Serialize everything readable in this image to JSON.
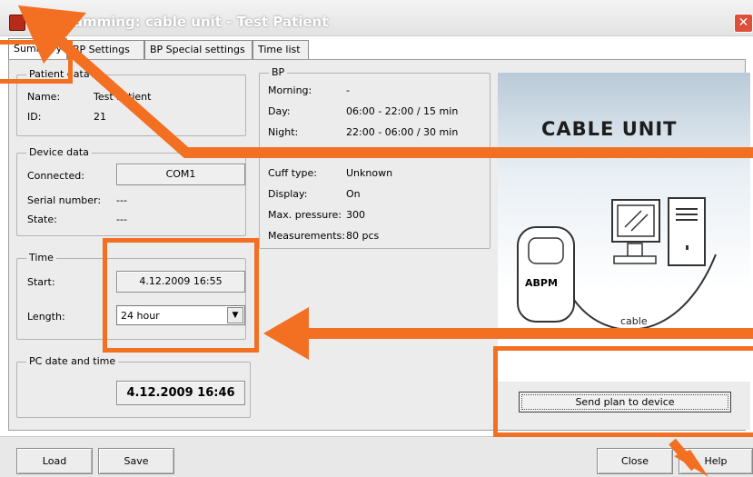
{
  "window": {
    "title": "Programming: cable unit - Test Patient",
    "close_glyph": "✕"
  },
  "tabs": [
    {
      "label": "Summary"
    },
    {
      "label": "BP Settings"
    },
    {
      "label": "BP Special settings"
    },
    {
      "label": "Time list"
    }
  ],
  "patient": {
    "group": "Patient data",
    "name_label": "Name:",
    "name_value": "Test Patient",
    "id_label": "ID:",
    "id_value": "21"
  },
  "device": {
    "group": "Device data",
    "connected_label": "Connected:",
    "connected_value": "COM1",
    "serial_label": "Serial number:",
    "serial_value": "---",
    "state_label": "State:",
    "state_value": "---"
  },
  "time": {
    "group": "Time",
    "start_label": "Start:",
    "start_value": "4.12.2009 16:55",
    "length_label": "Length:",
    "length_value": "24 hour"
  },
  "pc": {
    "group": "PC date and time",
    "value": "4.12.2009 16:46"
  },
  "bp": {
    "group": "BP",
    "morning_label": "Morning:",
    "morning_value": "-",
    "day_label": "Day:",
    "day_value": "06:00 - 22:00 / 15 min",
    "night_label": "Night:",
    "night_value": "22:00 - 06:00 / 30 min",
    "cuff_label": "Cuff type:",
    "cuff_value": "Unknown",
    "display_label": "Display:",
    "display_value": "On",
    "maxp_label": "Max. pressure:",
    "maxp_value": "300",
    "meas_label": "Measurements:",
    "meas_value": "80 pcs"
  },
  "image": {
    "title": "CABLE UNIT",
    "abpm_label": "ABPM",
    "cable_label": "cable"
  },
  "send_button": "Send plan to device",
  "buttons": {
    "load": "Load",
    "save": "Save",
    "close": "Close",
    "help": "Help"
  },
  "colors": {
    "annotation": "#f36f22",
    "titlebar_close": "#dd4f38"
  }
}
